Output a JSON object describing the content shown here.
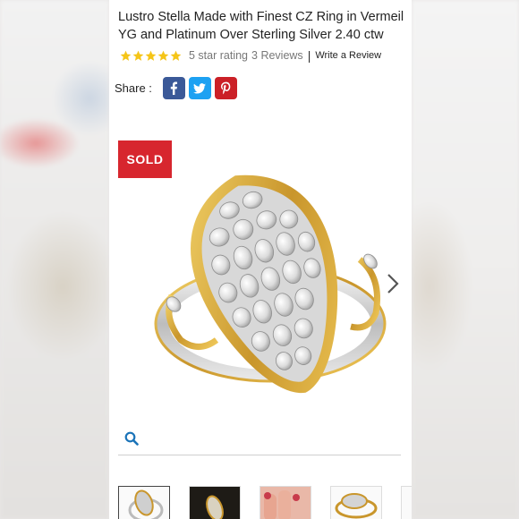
{
  "product": {
    "title": "Lustro Stella Made with Finest CZ Ring in Vermeil YG and Platinum Over Sterling Silver 2.40 ctw"
  },
  "rating": {
    "stars": 5,
    "text": "5 star rating",
    "reviews": "3 Reviews",
    "separator": "|",
    "write_review": "Write a Review"
  },
  "share": {
    "label": "Share :",
    "icons": [
      "facebook-icon",
      "twitter-icon",
      "pinterest-icon"
    ]
  },
  "badge": {
    "label": "SOLD",
    "color": "#d7262e"
  },
  "gallery": {
    "next_icon": "chevron-right-icon",
    "zoom_icon": "search-icon",
    "thumbnails": [
      "ring-front",
      "ring-dark",
      "ring-on-hand",
      "ring-side",
      "ring-more"
    ]
  },
  "colors": {
    "facebook": "#3b5998",
    "twitter": "#1da1f2",
    "pinterest": "#cb2027",
    "star": "#f5c518",
    "zoom": "#1a73b8"
  }
}
